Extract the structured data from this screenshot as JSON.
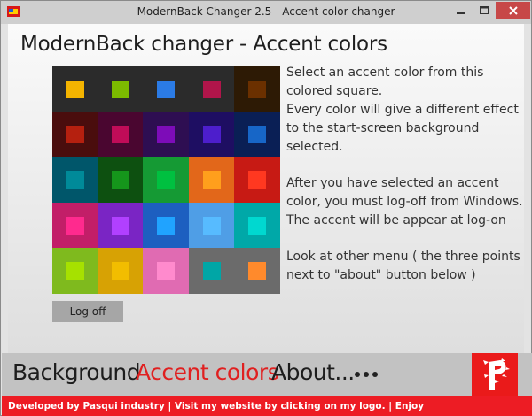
{
  "window": {
    "title": "ModernBack Changer 2.5 - Accent color changer",
    "buttons": {
      "minimize": "minimize-icon",
      "maximize": "maximize-icon",
      "close": "close-icon"
    }
  },
  "main": {
    "heading": "ModernBack changer - Accent colors",
    "description1": [
      "Select an accent color from this",
      "colored square.",
      "Every color will give a different effect",
      "to the start-screen background",
      "selected."
    ],
    "description2": [
      "After you have selected an accent",
      "color, you must log-off from Windows.",
      "The accent will be appear at log-on"
    ],
    "description3": [
      "Look at other menu ( the three points",
      "next to \"about\" button below )"
    ],
    "logoff_label": "Log off"
  },
  "palette": [
    [
      {
        "bg": "#2b2b2b",
        "fg": "#f4b400"
      },
      {
        "bg": "#2b2b2b",
        "fg": "#7cbb00"
      },
      {
        "bg": "#2b2b2b",
        "fg": "#2b7be5"
      },
      {
        "bg": "#2b2b2b",
        "fg": "#b0154a"
      },
      {
        "bg": "#2d1a05",
        "fg": "#6b3000"
      }
    ],
    [
      {
        "bg": "#4a0d0d",
        "fg": "#b5200f"
      },
      {
        "bg": "#4a0630",
        "fg": "#c00c58"
      },
      {
        "bg": "#2e0e52",
        "fg": "#7d0cb8"
      },
      {
        "bg": "#1e0e62",
        "fg": "#4d1ecc"
      },
      {
        "bg": "#0a1f55",
        "fg": "#1766c7"
      }
    ],
    [
      {
        "bg": "#00566a",
        "fg": "#008a99"
      },
      {
        "bg": "#0d5010",
        "fg": "#15961b"
      },
      {
        "bg": "#159a34",
        "fg": "#00c040"
      },
      {
        "bg": "#e2671a",
        "fg": "#ff9f1c"
      },
      {
        "bg": "#c71a14",
        "fg": "#ff3820"
      }
    ],
    [
      {
        "bg": "#c21e68",
        "fg": "#ff2a8e"
      },
      {
        "bg": "#7a25c4",
        "fg": "#b140ff"
      },
      {
        "bg": "#1d5fc0",
        "fg": "#20a3ff"
      },
      {
        "bg": "#4f9ee6",
        "fg": "#57bbff"
      },
      {
        "bg": "#00a8a8",
        "fg": "#00d8d0"
      }
    ],
    [
      {
        "bg": "#7fba1e",
        "fg": "#a6e100"
      },
      {
        "bg": "#d7a204",
        "fg": "#f2bd00"
      },
      {
        "bg": "#e06bb2",
        "fg": "#ff8acd"
      },
      {
        "bg": "#6b6b6b",
        "fg": "#00a6a6"
      },
      {
        "bg": "#6b6b6b",
        "fg": "#ff8a2c"
      }
    ]
  ],
  "nav": {
    "background": "Background",
    "accent_colors": "Accent colors",
    "about": "About...",
    "more_icon": "more-dots-icon",
    "logo_icon": "pasqui-logo-icon"
  },
  "footer": {
    "text": "Developed by Pasqui industry   |   Visit my website by clicking on my logo.   |   Enjoy"
  },
  "colors": {
    "accent": "#e02020",
    "footer_bg": "#ed1c24",
    "close_button": "#c74848"
  }
}
